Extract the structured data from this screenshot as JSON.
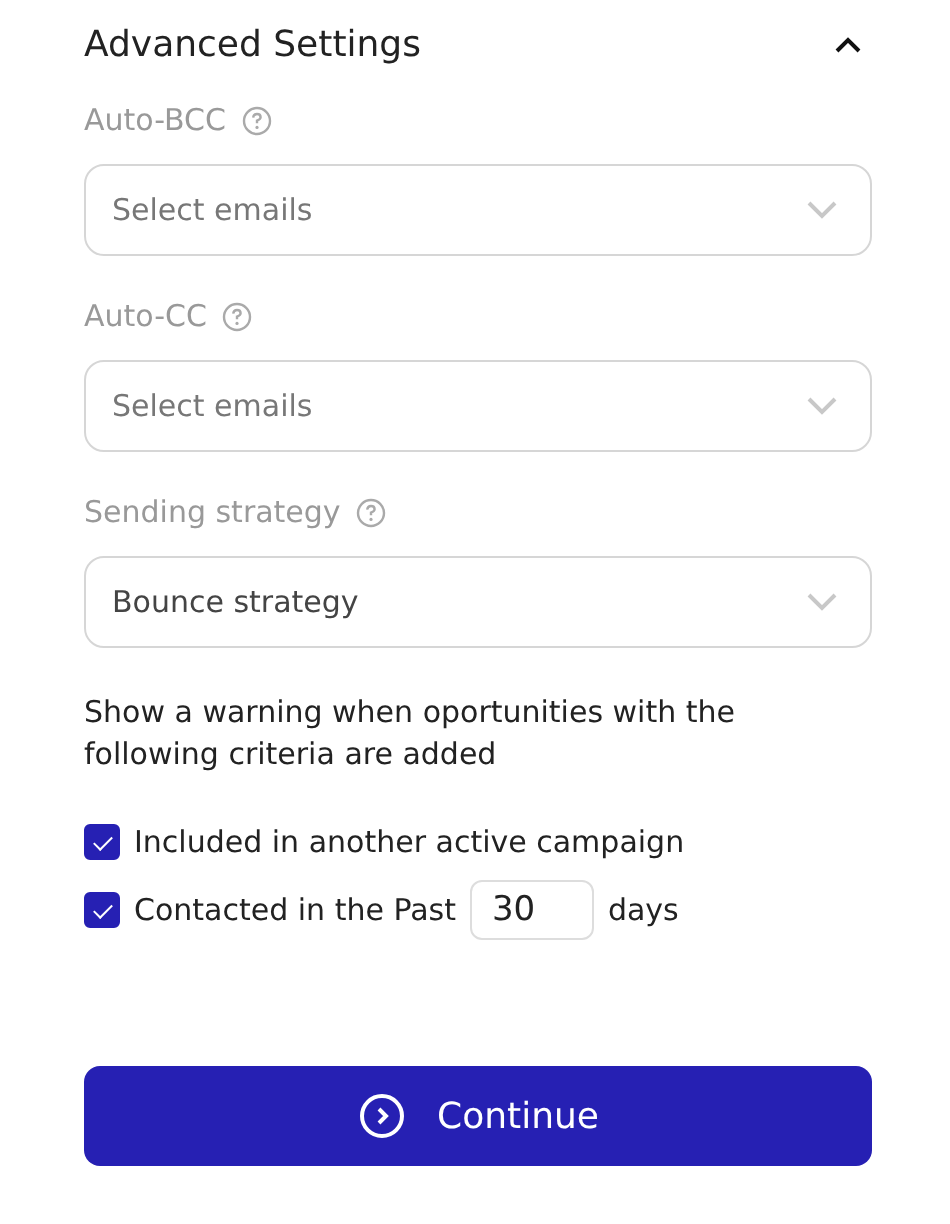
{
  "section": {
    "title": "Advanced Settings",
    "expanded": true
  },
  "fields": [
    {
      "label": "Auto-BCC",
      "placeholder": "Select emails"
    },
    {
      "label": "Auto-CC",
      "placeholder": "Select emails"
    },
    {
      "label": "Sending strategy",
      "value": "Bounce strategy"
    }
  ],
  "warning": {
    "text": "Show a warning when oportunities with the following criteria are added",
    "criteria": [
      {
        "kind": "plain",
        "label": "Included in another active campaign",
        "checked": true
      },
      {
        "kind": "days",
        "label": "Contacted in the Past",
        "value": "30",
        "suffix": "days",
        "checked": true
      }
    ]
  },
  "button": {
    "label": "Continue"
  }
}
